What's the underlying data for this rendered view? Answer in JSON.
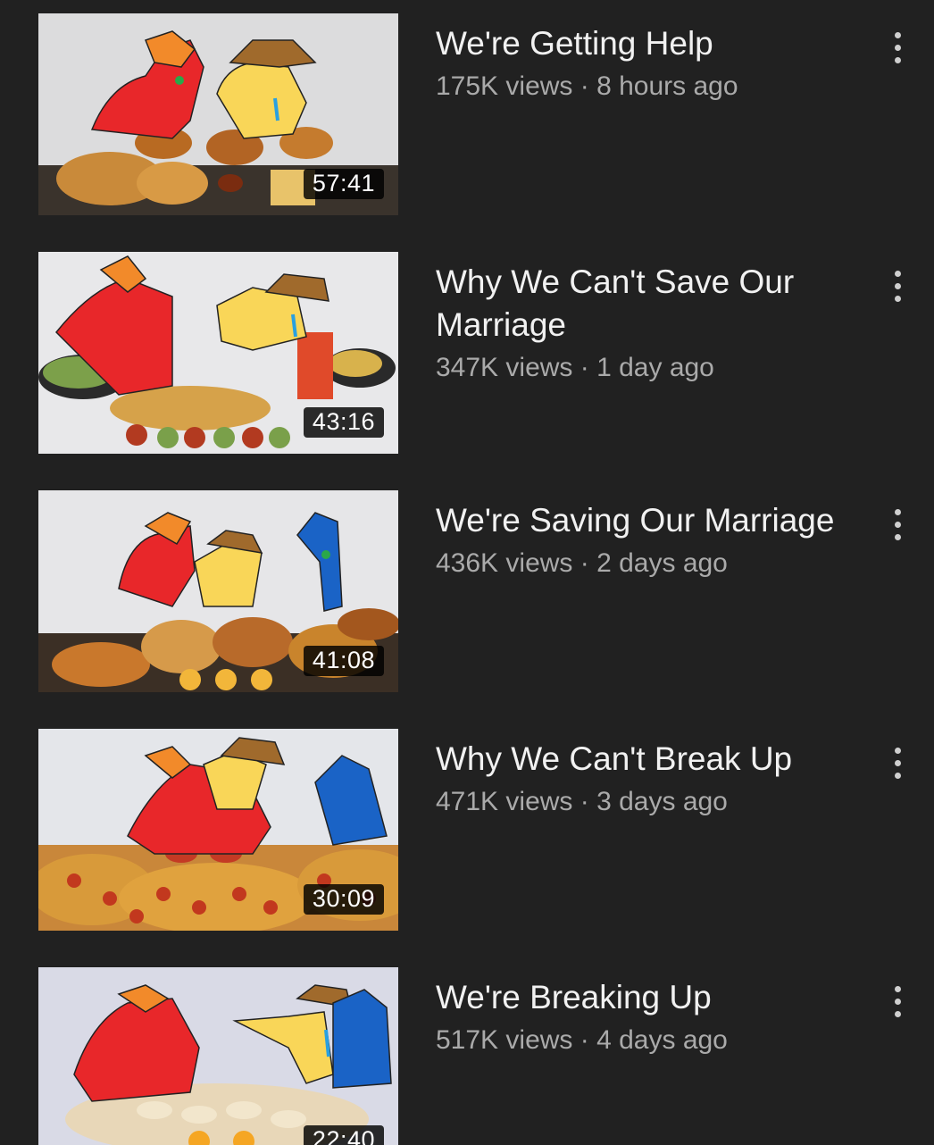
{
  "videos": [
    {
      "title": "We're Getting Help",
      "views": "175K views",
      "age": "8 hours ago",
      "duration": "57:41"
    },
    {
      "title": "Why We Can't Save Our Marriage",
      "views": "347K views",
      "age": "1 day ago",
      "duration": "43:16"
    },
    {
      "title": "We're Saving Our Marriage",
      "views": "436K views",
      "age": "2 days ago",
      "duration": "41:08"
    },
    {
      "title": "Why We Can't Break Up",
      "views": "471K views",
      "age": "3 days ago",
      "duration": "30:09"
    },
    {
      "title": "We're Breaking Up",
      "views": "517K views",
      "age": "4 days ago",
      "duration": "22:40"
    }
  ],
  "meta_separator": " · ",
  "icons": {
    "more": "more-vert-icon"
  },
  "colors": {
    "background": "#212121",
    "title": "#f1f1f1",
    "meta": "#aaaaaa",
    "red_character": "#e8272a",
    "yellow_character": "#f9d658",
    "blue_character": "#1a63c6",
    "hat_brown": "#a06a2c"
  }
}
